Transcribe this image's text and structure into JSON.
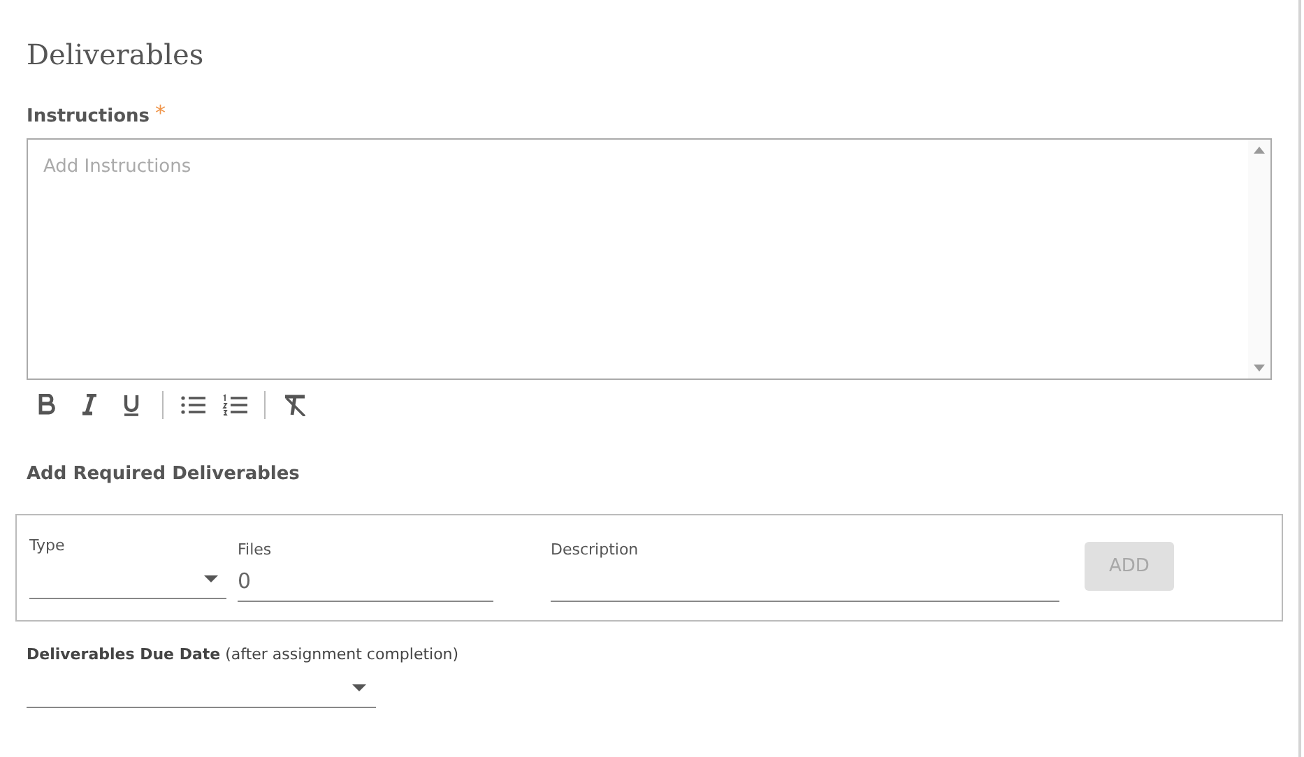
{
  "title": "Deliverables",
  "instructions": {
    "label": "Instructions",
    "required_mark": "*",
    "placeholder": "Add Instructions"
  },
  "toolbar": [
    {
      "kind": "bold"
    },
    {
      "kind": "italic"
    },
    {
      "kind": "underline"
    },
    {
      "kind": "divider"
    },
    {
      "kind": "bullets"
    },
    {
      "kind": "numbers"
    },
    {
      "kind": "divider"
    },
    {
      "kind": "clear"
    }
  ],
  "required_deliverables": {
    "heading": "Add Required Deliverables",
    "type": {
      "label": "Type"
    },
    "files": {
      "label": "Files",
      "value": "0"
    },
    "description": {
      "label": "Description"
    },
    "add_button": {
      "label": "ADD",
      "disabled": true
    }
  },
  "due_date": {
    "label": "Deliverables Due Date",
    "note": "(after assignment completion)"
  }
}
